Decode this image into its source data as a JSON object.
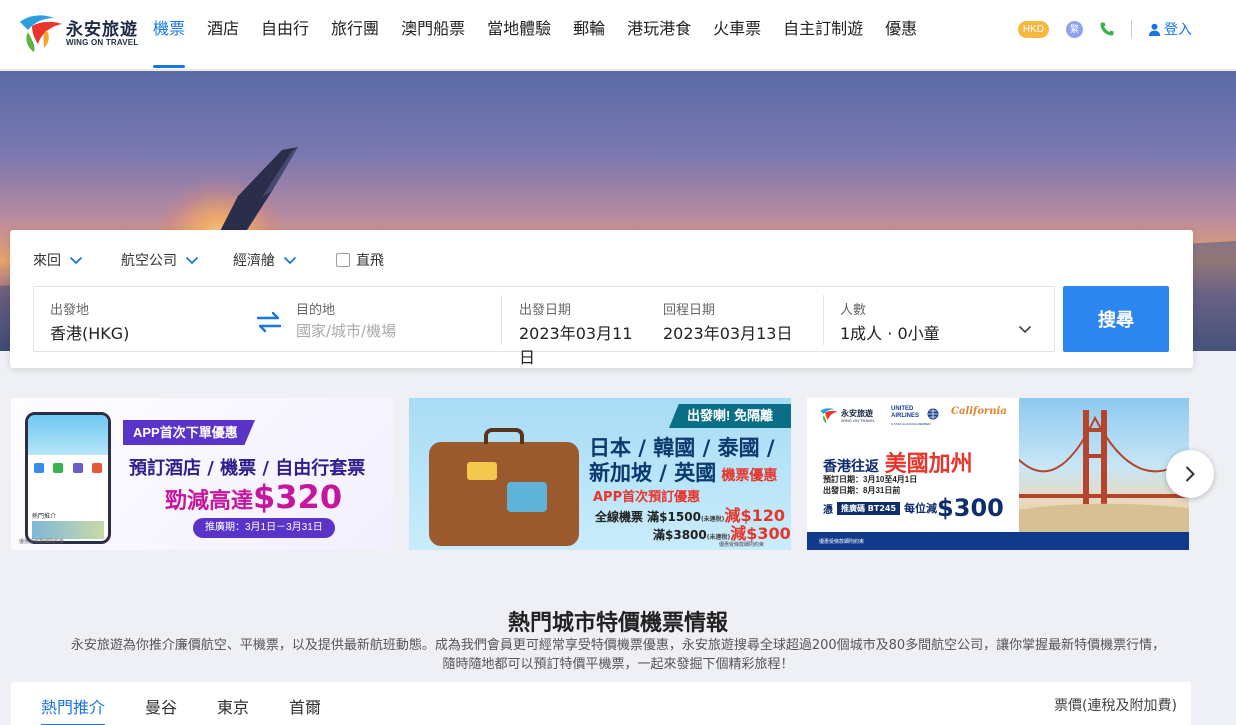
{
  "brand": {
    "name_cn": "永安旅遊",
    "name_en": "WING ON TRAVEL"
  },
  "nav": [
    {
      "label": "機票",
      "active": true
    },
    {
      "label": "酒店"
    },
    {
      "label": "自由行"
    },
    {
      "label": "旅行團"
    },
    {
      "label": "澳門船票"
    },
    {
      "label": "當地體驗"
    },
    {
      "label": "郵輪"
    },
    {
      "label": "港玩港食"
    },
    {
      "label": "火車票"
    },
    {
      "label": "自主訂制遊"
    },
    {
      "label": "優惠"
    }
  ],
  "header_right": {
    "currency": "HKD",
    "lang_symbol": "繁",
    "login": "登入"
  },
  "search": {
    "trip_type": "來回",
    "airline": "航空公司",
    "cabin": "經濟艙",
    "direct": "直飛",
    "origin_label": "出發地",
    "origin_value": "香港(HKG)",
    "dest_label": "目的地",
    "dest_placeholder": "國家/城市/機場",
    "depart_label": "出發日期",
    "depart_value": "2023年03月11日",
    "return_label": "回程日期",
    "return_value": "2023年03月13日",
    "pax_label": "人數",
    "pax_value": "1成人 · 0小童",
    "button": "搜尋"
  },
  "banners": [
    {
      "tag": "APP首次下單優惠",
      "line1": "預訂酒店 / 機票 / 自由行套票",
      "line2_prefix": "勁減高達",
      "line2_amount": "$320",
      "period": "推廣期：3月1日－3月31日",
      "fine": "優惠受條款細則約束",
      "app_label": "熱門推介"
    },
    {
      "tag": "出發喇! 免隔離",
      "line1": "日本 / 韓國 / 泰國 /",
      "line2": "新加坡 / 英國",
      "line2_suffix": "機票優惠",
      "offer_title": "APP首次預訂優惠",
      "offer1_prefix": "全線機票 滿$1500",
      "offer1_note": "(未連稅)",
      "offer1_off": "減$120",
      "offer2_prefix": "滿$3800",
      "offer2_note": "(未連稅)",
      "offer2_off": "減$300",
      "fine": "優惠受條款細則約束"
    },
    {
      "logo_cn": "永安旅遊",
      "logo_en": "WING ON TRAVEL",
      "airline": "UNITED AIRLINES",
      "airline_sub": "A STAR ALLIANCE MEMBER",
      "california": "California",
      "headline_prefix": "香港往返",
      "headline": "美國加州",
      "book_date": "預訂日期：3月10至4月1日",
      "depart_date": "出發日期：8月31日前",
      "code_prefix": "憑",
      "code": "推廣碼 BT245",
      "code_suffix": "每位減",
      "amount": "$300",
      "fine": "優惠受條款細則約束"
    }
  ],
  "section": {
    "title": "熱門城市特價機票情報",
    "desc_line1": "永安旅遊為你推介廉價航空、平機票，以及提供最新航班動態。成為我們會員更可經常享受特價機票優惠，永安旅遊搜尋全球超過200個城市及80多間航空公司，讓你掌握最新特價機票行情，",
    "desc_line2": "隨時隨地都可以預訂特價平機票，一起來發掘下個精彩旅程！",
    "tabs": [
      "熱門推介",
      "曼谷",
      "東京",
      "首爾"
    ],
    "price_note": "票價(連稅及附加費)"
  },
  "colors": {
    "accent": "#1976e1",
    "button": "#2d86f0"
  }
}
